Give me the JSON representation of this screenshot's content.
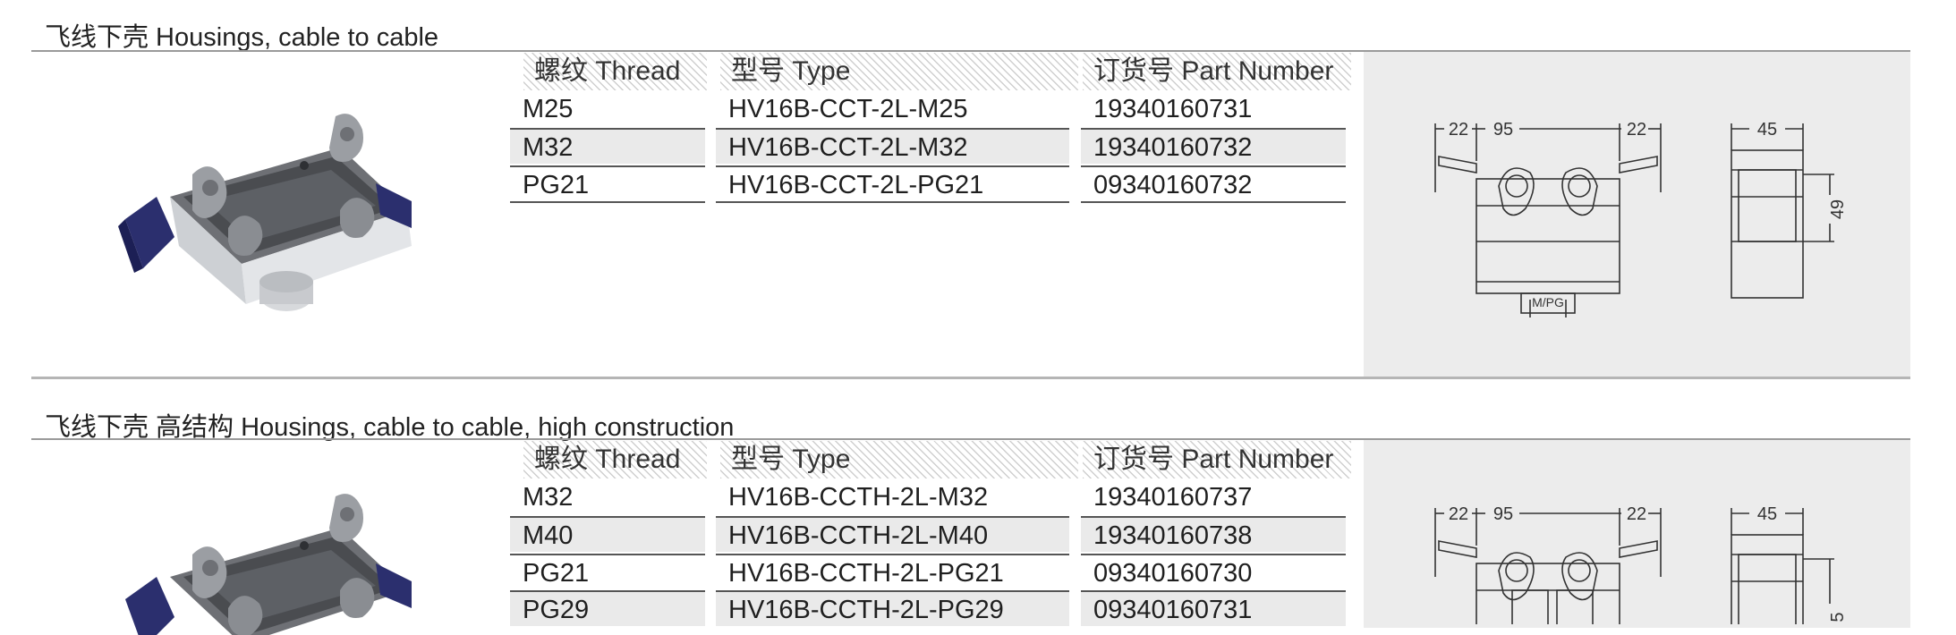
{
  "sections": [
    {
      "title": "飞线下壳 Housings, cable to cable",
      "headers": {
        "thread": "螺纹 Thread",
        "type": "型号 Type",
        "part": "订货号 Part Number"
      },
      "rows": [
        {
          "thread": "M25",
          "type": "HV16B-CCT-2L-M25",
          "part": "19340160731"
        },
        {
          "thread": "M32",
          "type": "HV16B-CCT-2L-M32",
          "part": "19340160732"
        },
        {
          "thread": "PG21",
          "type": "HV16B-CCT-2L-PG21",
          "part": "09340160732"
        }
      ],
      "dims": {
        "left": "22",
        "mid": "95",
        "right": "22",
        "side": "45",
        "height": "49",
        "gland": "M/PG"
      }
    },
    {
      "title": "飞线下壳 高结构 Housings, cable to cable, high construction",
      "headers": {
        "thread": "螺纹 Thread",
        "type": "型号 Type",
        "part": "订货号 Part Number"
      },
      "rows": [
        {
          "thread": "M32",
          "type": "HV16B-CCTH-2L-M32",
          "part": "19340160737"
        },
        {
          "thread": "M40",
          "type": "HV16B-CCTH-2L-M40",
          "part": "19340160738"
        },
        {
          "thread": "PG21",
          "type": "HV16B-CCTH-2L-PG21",
          "part": "09340160730"
        },
        {
          "thread": "PG29",
          "type": "HV16B-CCTH-2L-PG29",
          "part": "09340160731"
        }
      ],
      "dims": {
        "left": "22",
        "mid": "95",
        "right": "22",
        "side": "45",
        "height": "5"
      }
    }
  ]
}
